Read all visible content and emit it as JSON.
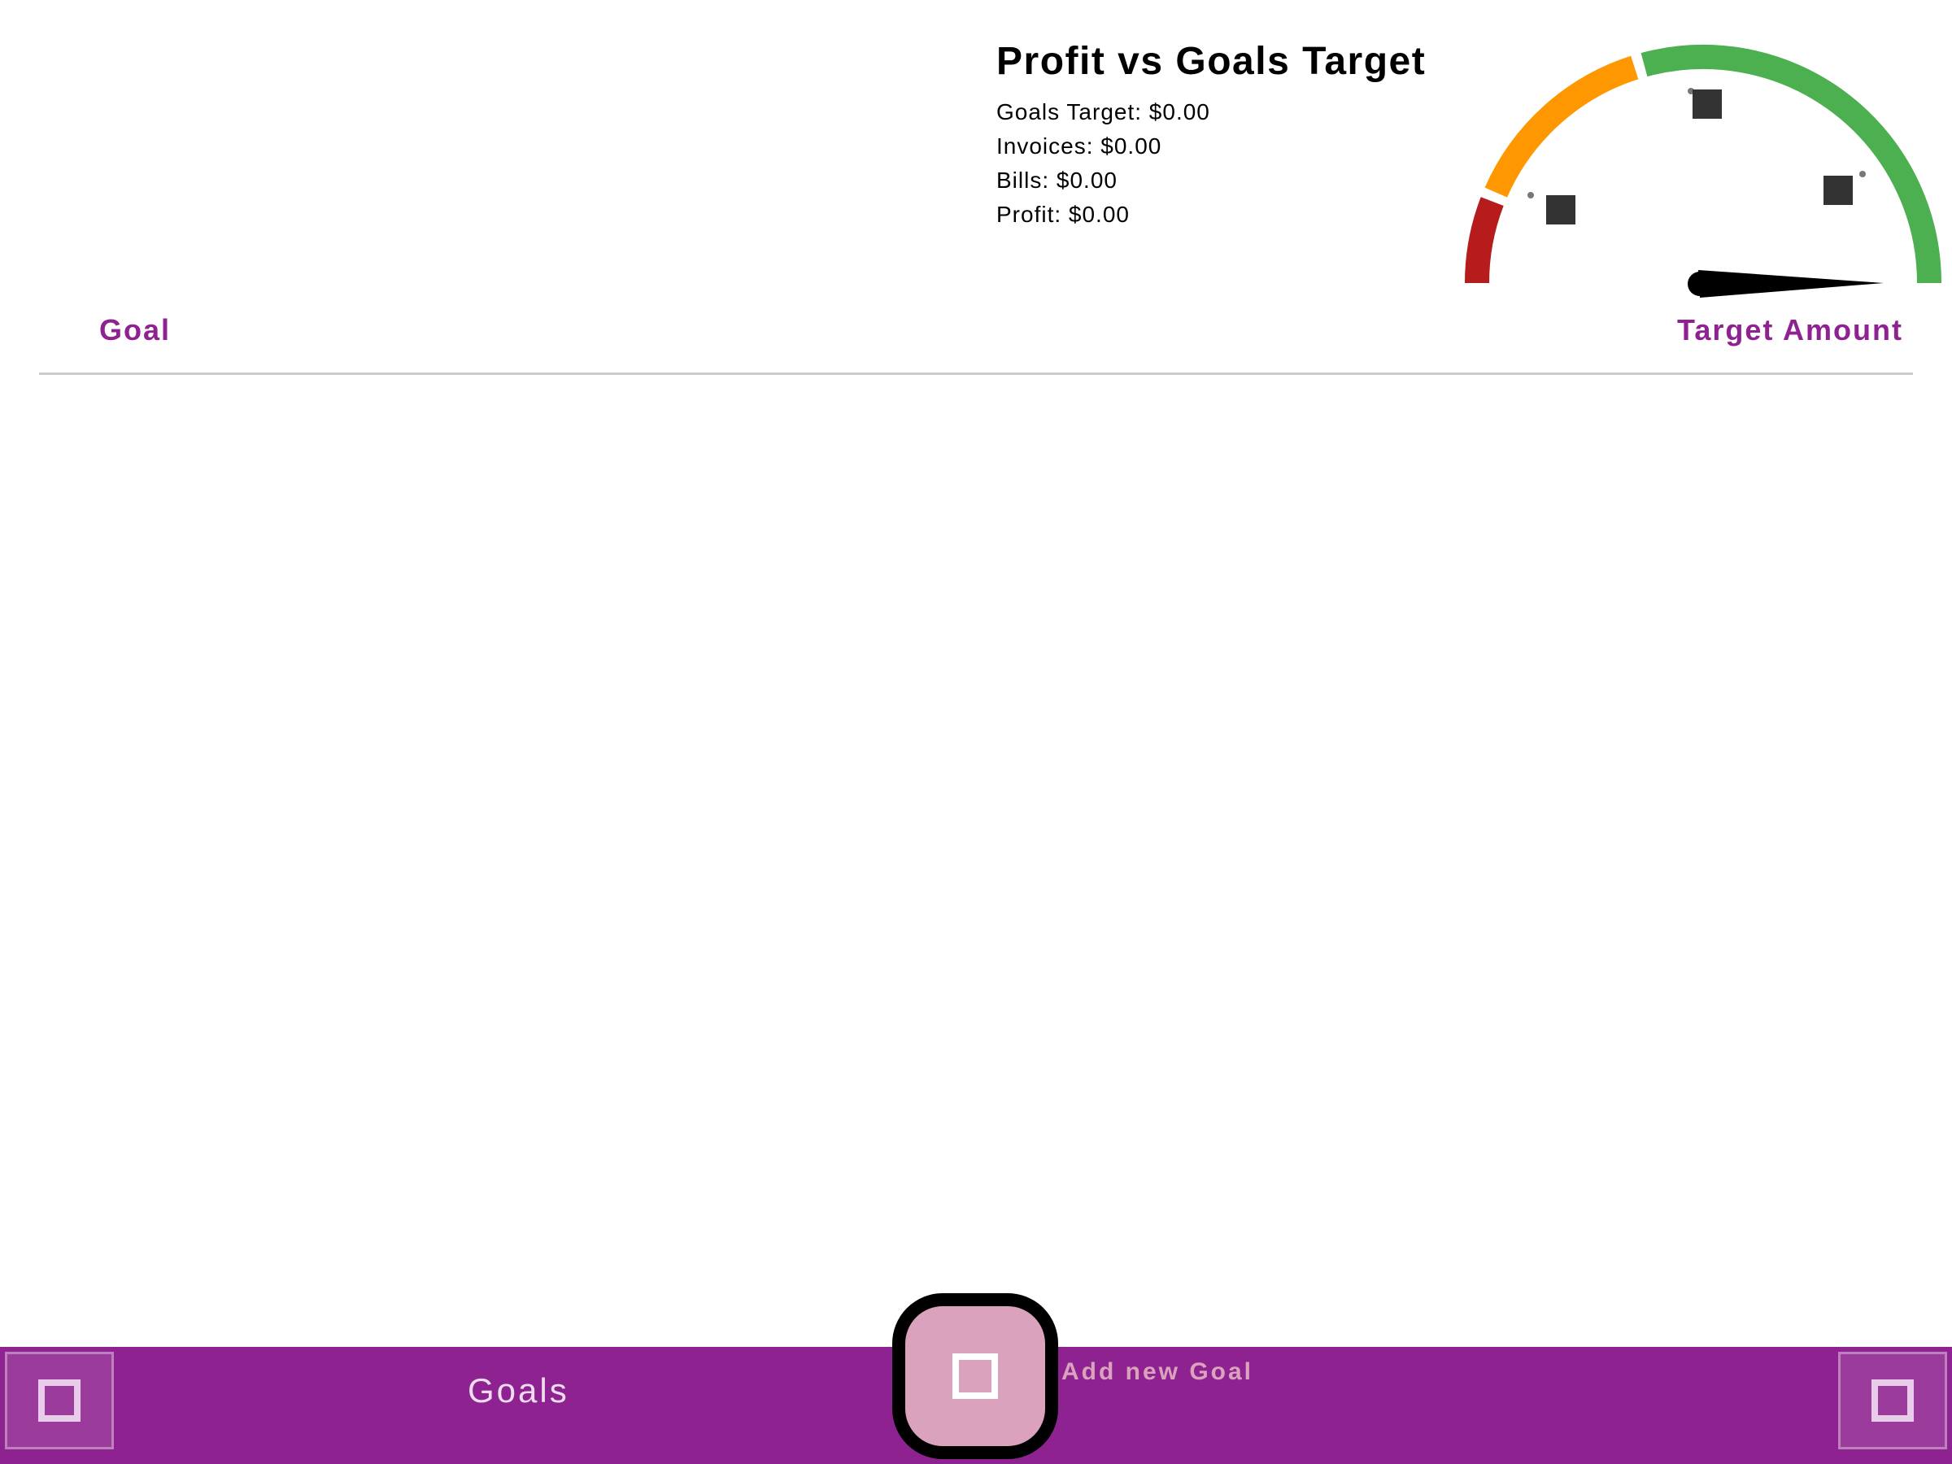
{
  "summary": {
    "title": "Profit vs Goals Target",
    "goals_target": "Goals Target: $0.00",
    "invoices": "Invoices: $0.00",
    "bills": "Bills: $0.00",
    "profit": "Profit: $0.00"
  },
  "gauge": {
    "zones": [
      {
        "color": "#b71c1c"
      },
      {
        "color": "#ff9800"
      },
      {
        "color": "#4caf50"
      }
    ],
    "needle_color": "#000000",
    "marker_color": "#333333"
  },
  "table": {
    "col_goal": "Goal",
    "col_target": "Target Amount"
  },
  "bottom_bar": {
    "title": "Goals",
    "fab_label": "Add new Goal",
    "left_icon": "square-icon",
    "right_icon": "square-icon",
    "fab_icon": "square-icon"
  },
  "colors": {
    "accent": "#8e2290",
    "fab": "#dba2bd",
    "divider": "#cccccc"
  }
}
